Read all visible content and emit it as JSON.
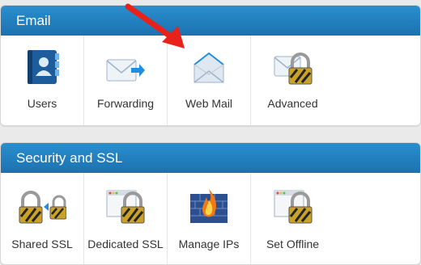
{
  "email_panel": {
    "title": "Email",
    "tiles": [
      {
        "label": "Users",
        "icon": "address-book-icon"
      },
      {
        "label": "Forwarding",
        "icon": "forward-mail-icon"
      },
      {
        "label": "Web Mail",
        "icon": "open-envelope-icon"
      },
      {
        "label": "Advanced",
        "icon": "locked-envelope-icon"
      }
    ]
  },
  "security_panel": {
    "title": "Security and SSL",
    "tiles": [
      {
        "label": "Shared SSL",
        "icon": "shared-locks-icon"
      },
      {
        "label": "Dedicated SSL",
        "icon": "window-lock-icon"
      },
      {
        "label": "Manage IPs",
        "icon": "firewall-icon"
      },
      {
        "label": "Set Offline",
        "icon": "window-lock-icon"
      }
    ]
  },
  "annotation": {
    "arrow_color": "#e8211a",
    "icon": "red-arrow-icon"
  },
  "colors": {
    "header": "#1f78b9",
    "label": "#333333"
  }
}
